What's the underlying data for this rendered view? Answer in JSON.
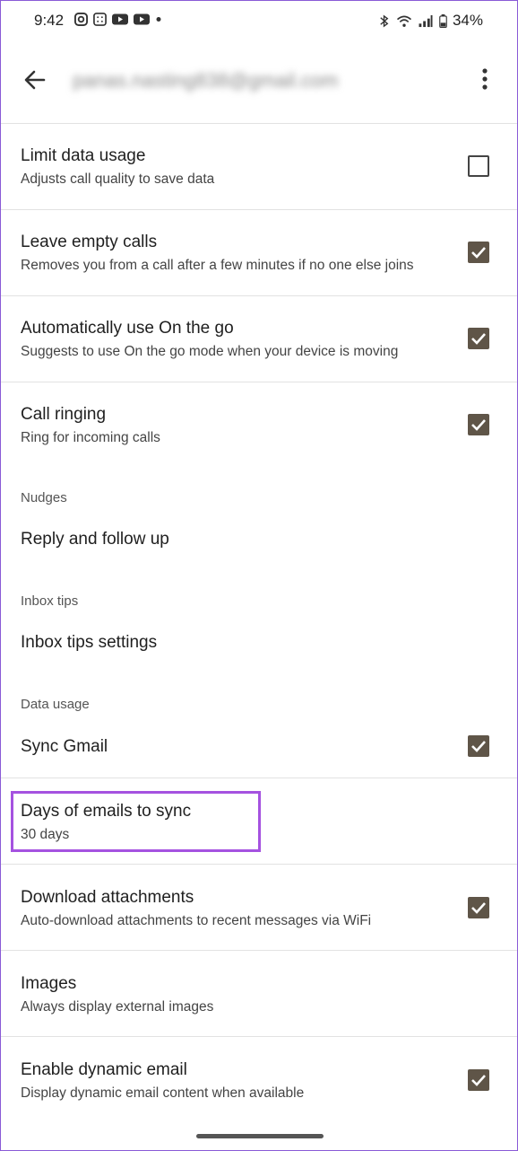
{
  "status_bar": {
    "time": "9:42",
    "battery": "34%",
    "left_icons": [
      "instagram-icon",
      "grid-app-icon",
      "youtube-icon",
      "youtube-icon",
      "dot-icon"
    ],
    "right_icons": [
      "bluetooth-icon",
      "wifi-icon",
      "signal-icon",
      "battery-icon"
    ]
  },
  "toolbar": {
    "account": "panas.nasting838@gmail.com",
    "back_icon": "arrow-left-icon",
    "more_icon": "more-vert-icon"
  },
  "settings": {
    "limit_data": {
      "title": "Limit data usage",
      "subtitle": "Adjusts call quality to save data",
      "checked": false
    },
    "leave_empty": {
      "title": "Leave empty calls",
      "subtitle": "Removes you from a call after a few minutes if no one else joins",
      "checked": true
    },
    "on_the_go": {
      "title": "Automatically use On the go",
      "subtitle": "Suggests to use On the go mode when your device is moving",
      "checked": true
    },
    "call_ringing": {
      "title": "Call ringing",
      "subtitle": "Ring for incoming calls",
      "checked": true
    },
    "nudges_header": "Nudges",
    "reply_follow": {
      "title": "Reply and follow up"
    },
    "inbox_tips_header": "Inbox tips",
    "inbox_tips": {
      "title": "Inbox tips settings"
    },
    "data_usage_header": "Data usage",
    "sync_gmail": {
      "title": "Sync Gmail",
      "checked": true
    },
    "days_sync": {
      "title": "Days of emails to sync",
      "subtitle": "30 days"
    },
    "download_attachments": {
      "title": "Download attachments",
      "subtitle": "Auto-download attachments to recent messages via WiFi",
      "checked": true
    },
    "images": {
      "title": "Images",
      "subtitle": "Always display external images"
    },
    "dynamic_email": {
      "title": "Enable dynamic email",
      "subtitle": "Display dynamic email content when available",
      "checked": true
    }
  },
  "colors": {
    "checkbox_checked": "#5f5548",
    "highlight": "#a552e0"
  }
}
